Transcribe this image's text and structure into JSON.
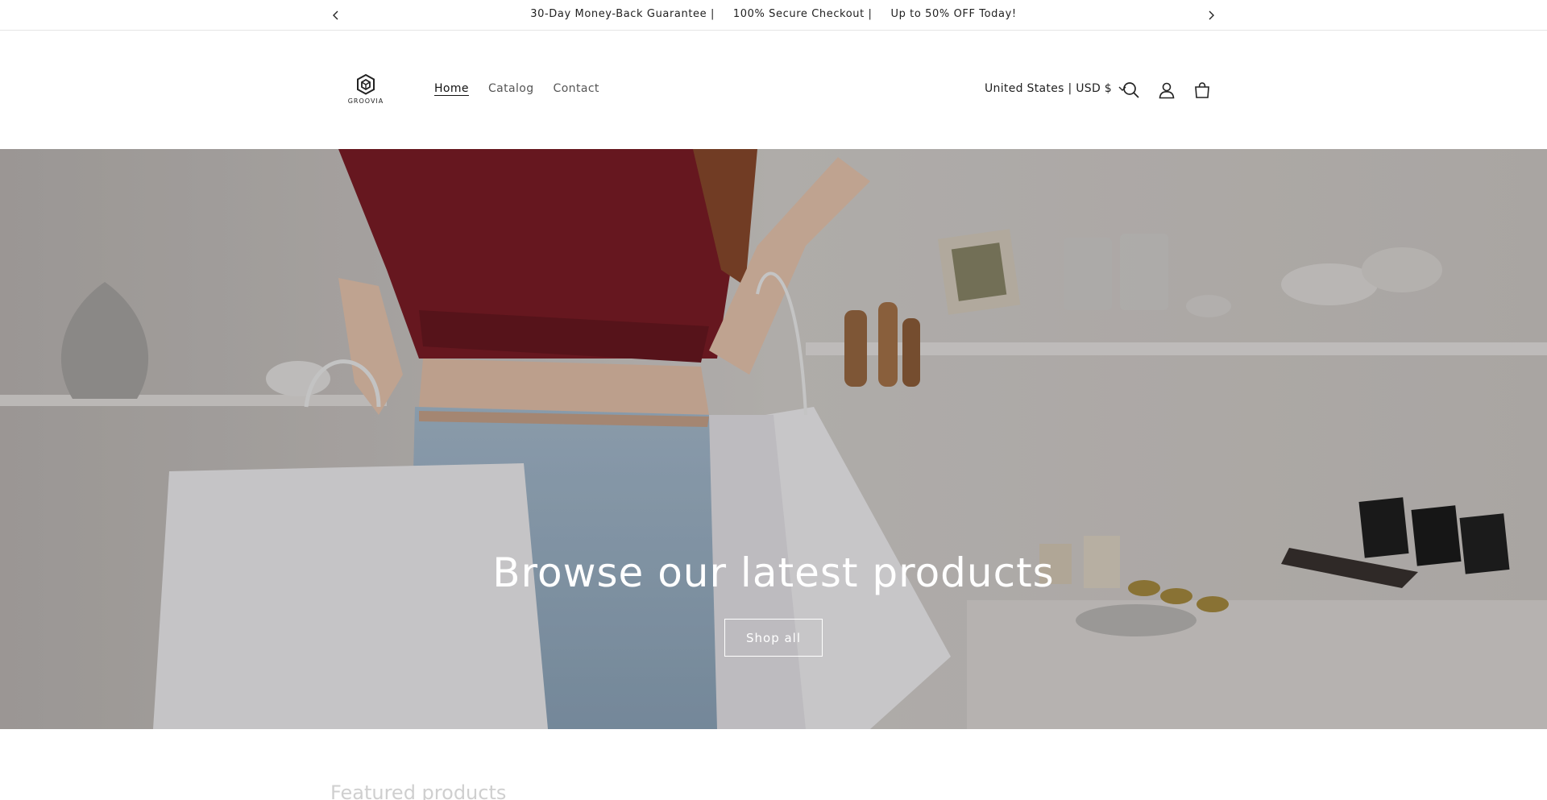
{
  "announcement": {
    "messages": [
      "30-Day Money-Back Guarantee |",
      "100% Secure Checkout |",
      "Up to 50% OFF Today!"
    ],
    "prev_icon": "chevron-left-icon",
    "next_icon": "chevron-right-icon"
  },
  "header": {
    "logo_text": "GROOVIA",
    "nav": [
      {
        "label": "Home",
        "active": true
      },
      {
        "label": "Catalog",
        "active": false
      },
      {
        "label": "Contact",
        "active": false
      }
    ],
    "localization": "United States | USD $",
    "icons": [
      "search-icon",
      "account-icon",
      "cart-icon"
    ]
  },
  "hero": {
    "title": "Browse our latest products",
    "button_label": "Shop all"
  },
  "below": {
    "section_title": "Featured products"
  },
  "colors": {
    "text": "#121212",
    "muted": "#555555",
    "hero_text": "#ffffff",
    "shirt": "#7d1d26",
    "denim": "#9fb6c9"
  }
}
